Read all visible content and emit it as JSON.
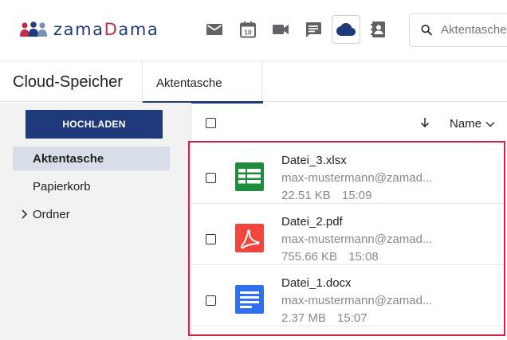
{
  "header": {
    "logo": {
      "prefix": "zama",
      "accent": "D",
      "suffix": "ama"
    },
    "apps": [
      {
        "icon": "mail-icon",
        "label": "Mail"
      },
      {
        "icon": "calendar-icon",
        "label": "10"
      },
      {
        "icon": "video-icon",
        "label": "Video"
      },
      {
        "icon": "chat-icon",
        "label": "Chat"
      },
      {
        "icon": "cloud-icon",
        "label": "Cloud",
        "active": true
      },
      {
        "icon": "contacts-icon",
        "label": "Kontakte"
      }
    ],
    "search": {
      "placeholder": "Aktentasche"
    }
  },
  "titlebar": {
    "title": "Cloud-Speicher",
    "tab": "Aktentasche"
  },
  "sidebar": {
    "upload_label": "HOCHLADEN",
    "items": [
      {
        "label": "Aktentasche",
        "selected": true
      },
      {
        "label": "Papierkorb"
      },
      {
        "label": "Ordner",
        "expandable": true
      }
    ]
  },
  "list": {
    "sort_label": "Name",
    "files": [
      {
        "name": "Datei_3.xlsx",
        "owner": "max-mustermann@zamad...",
        "size": "22.51 KB",
        "time": "15:09",
        "type": "spreadsheet"
      },
      {
        "name": "Datei_2.pdf",
        "owner": "max-mustermann@zamad...",
        "size": "755.66 KB",
        "time": "15:08",
        "type": "pdf"
      },
      {
        "name": "Datei_1.docx",
        "owner": "max-mustermann@zamad...",
        "size": "2.37 MB",
        "time": "15:07",
        "type": "document"
      }
    ]
  },
  "colors": {
    "brand_navy": "#1e3a7a",
    "brand_red": "#c62a4b",
    "highlight": "#d12344",
    "spreadsheet": "#1e8e3e",
    "pdf": "#f1453d",
    "document": "#2f6ff0"
  }
}
